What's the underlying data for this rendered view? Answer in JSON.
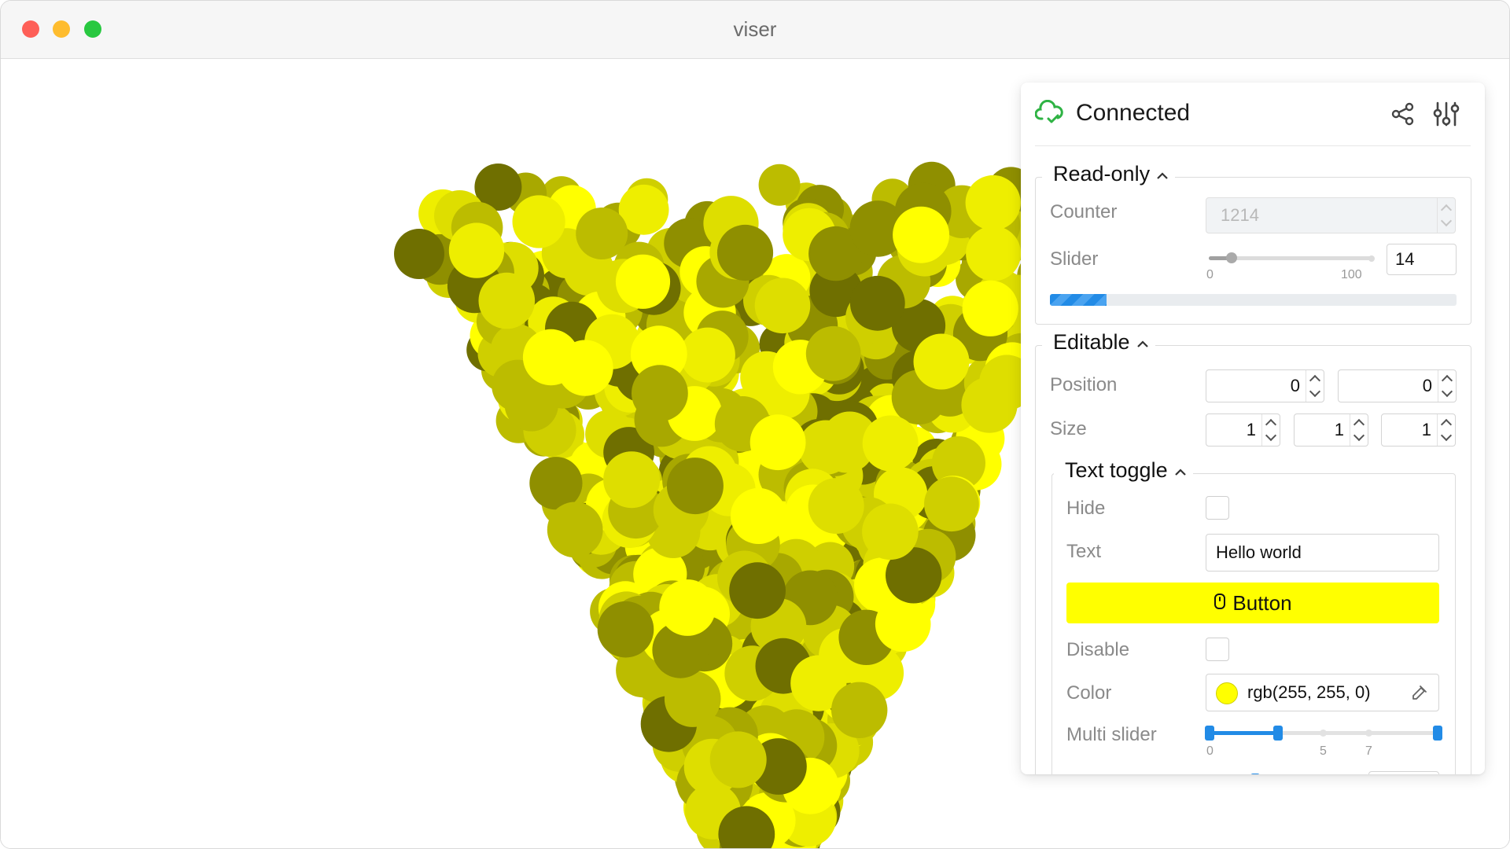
{
  "window": {
    "title": "viser"
  },
  "panel": {
    "status": "Connected",
    "read_only": {
      "title": "Read-only",
      "counter_label": "Counter",
      "counter_value": "1214",
      "slider_label": "Slider",
      "slider_value": "14",
      "slider_min": "0",
      "slider_max": "100",
      "progress_percent": 14
    },
    "editable": {
      "title": "Editable",
      "position_label": "Position",
      "position_values": [
        "0",
        "0"
      ],
      "size_label": "Size",
      "size_values": [
        "1",
        "1",
        "1"
      ]
    },
    "text_toggle": {
      "title": "Text toggle",
      "hide_label": "Hide",
      "text_label": "Text",
      "text_value": "Hello world",
      "button_label": "Button",
      "disable_label": "Disable",
      "color_label": "Color",
      "color_value": "rgb(255, 255, 0)",
      "multi_slider_label": "Multi slider",
      "multi_slider_ticks": [
        "0",
        "5",
        "7"
      ]
    }
  },
  "colors": {
    "accent": "#228be6",
    "button": "#ffff00",
    "connected": "#2fb344",
    "point_palette": [
      "#6f6f00",
      "#8f8f00",
      "#a8a800",
      "#bcbc00",
      "#cfcf00",
      "#dede00",
      "#eeee00",
      "#ffff00"
    ]
  },
  "icons": {
    "status": "cloud-check-icon",
    "share": "share-icon",
    "settings": "adjustments-icon",
    "button": "mouse-icon",
    "color_picker": "eyedropper-icon"
  }
}
